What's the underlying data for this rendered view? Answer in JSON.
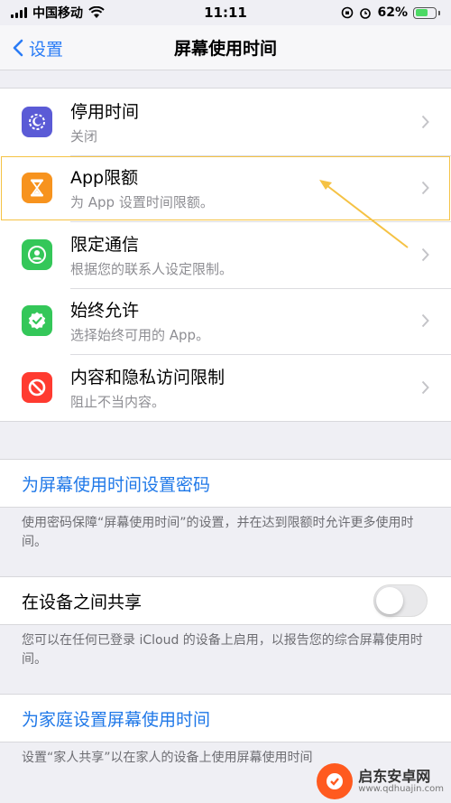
{
  "status_bar": {
    "carrier": "中国移动",
    "time": "11:11",
    "battery_percent": "62%",
    "battery_level": 0.62
  },
  "nav": {
    "back_label": "设置",
    "title": "屏幕使用时间"
  },
  "main_group": {
    "rows": [
      {
        "title": "停用时间",
        "subtitle": "关闭",
        "icon": "downtime-icon",
        "color": "#5b5bd6"
      },
      {
        "title": "App限额",
        "subtitle": "为 App 设置时间限额。",
        "icon": "hourglass-icon",
        "color": "#f7931e"
      },
      {
        "title": "限定通信",
        "subtitle": "根据您的联系人设定限制。",
        "icon": "contact-icon",
        "color": "#34c759"
      },
      {
        "title": "始终允许",
        "subtitle": "选择始终可用的 App。",
        "icon": "checkmark-badge-icon",
        "color": "#34c759"
      },
      {
        "title": "内容和隐私访问限制",
        "subtitle": "阻止不当内容。",
        "icon": "prohibited-icon",
        "color": "#ff3b30"
      }
    ]
  },
  "passcode": {
    "link": "为屏幕使用时间设置密码",
    "note": "使用密码保障“屏幕使用时间”的设置，并在达到限额时允许更多使用时间。"
  },
  "share": {
    "label": "在设备之间共享",
    "enabled": false,
    "note": "您可以在任何已登录 iCloud 的设备上启用，以报告您的综合屏幕使用时间。"
  },
  "family": {
    "link": "为家庭设置屏幕使用时间",
    "note": "设置“家人共享”以在家人的设备上使用屏幕使用时间"
  },
  "watermark": {
    "name": "启东安卓网",
    "url": "www.qdhuajin.com"
  },
  "colors": {
    "accent": "#1f78e8",
    "highlight": "#f5c244"
  }
}
